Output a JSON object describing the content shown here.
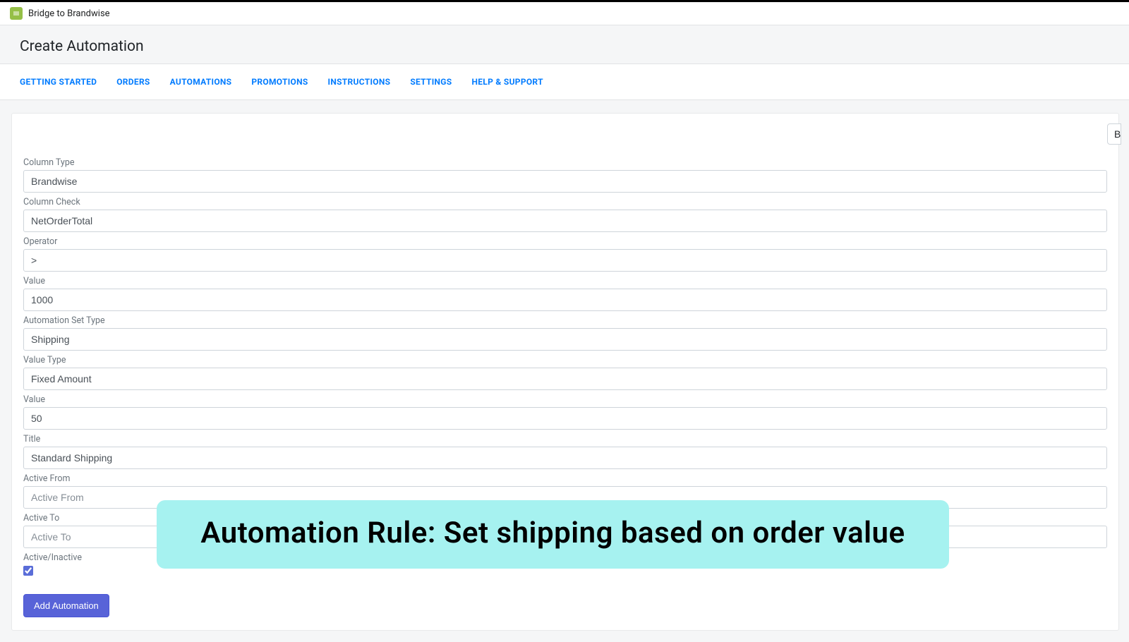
{
  "app": {
    "title": "Bridge to Brandwise"
  },
  "page": {
    "title": "Create Automation"
  },
  "tabs": [
    "GETTING STARTED",
    "ORDERS",
    "AUTOMATIONS",
    "PROMOTIONS",
    "INSTRUCTIONS",
    "SETTINGS",
    "HELP & SUPPORT"
  ],
  "topRightButton": "B",
  "form": {
    "columnType": {
      "label": "Column Type",
      "value": "Brandwise"
    },
    "columnCheck": {
      "label": "Column Check",
      "value": "NetOrderTotal"
    },
    "operator": {
      "label": "Operator",
      "value": ">"
    },
    "value1": {
      "label": "Value",
      "value": "1000"
    },
    "automationSetType": {
      "label": "Automation Set Type",
      "value": "Shipping"
    },
    "valueType": {
      "label": "Value Type",
      "value": "Fixed Amount"
    },
    "value2": {
      "label": "Value",
      "value": "50"
    },
    "title": {
      "label": "Title",
      "value": "Standard Shipping"
    },
    "activeFrom": {
      "label": "Active From",
      "value": "",
      "placeholder": "Active From"
    },
    "activeTo": {
      "label": "Active To",
      "value": "",
      "placeholder": "Active To"
    },
    "activeInactive": {
      "label": "Active/Inactive",
      "checked": true
    },
    "submitLabel": "Add Automation"
  },
  "callout": "Automation Rule: Set shipping based on order value"
}
